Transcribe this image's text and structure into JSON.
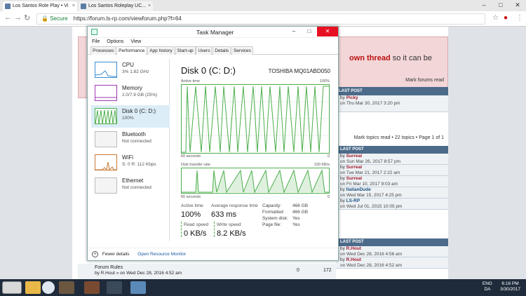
{
  "browser": {
    "tabs": [
      {
        "label": "Los Santos Role Play • Vi"
      },
      {
        "label": "Los Santos Roleplay UC..."
      }
    ],
    "url": "https://forum.ls-rp.com/viewforum.php?f=64",
    "secure_label": "Secure"
  },
  "forum": {
    "notice_thread": "own thread",
    "notice_tail": " so it can be",
    "mark_forums_read": "Mark forums read",
    "last_post_header": "LAST POST",
    "top_lastpost": {
      "by": "by",
      "user": "Picky",
      "on": "on Thu Mar 30, 2017 3:20 pm"
    },
    "topic_meta": "Mark topics read • 22 topics • Page 1 of 1",
    "announcements": [
      {
        "user": "Surreal",
        "on": "on Sun Mar 26, 2017 8:57 pm"
      },
      {
        "user": "Surreal",
        "on": "on Tue Mar 21, 2017 2:22 am"
      },
      {
        "user": "Surreal",
        "on": "on Fri Mar 10, 2017 9:03 am"
      },
      {
        "user": "ItalianDude",
        "on": "on Wed Mar 15, 2017 4:25 pm"
      },
      {
        "user": "LS-RP",
        "on": "on Wed Jul 01, 2015 10:05 pm"
      }
    ],
    "topics": [
      {
        "user": "R.Hout",
        "on": "on Wed Dec 28, 2016 4:56 am"
      },
      {
        "user": "R.Hout",
        "on": "on Wed Dec 28, 2016 4:52 am"
      }
    ],
    "bottom_row": {
      "title": "Forum Rules",
      "by": "by R.Hout » on Wed Dec 28, 2016 4:52 am",
      "replies": "0",
      "views": "172"
    }
  },
  "task_manager": {
    "title": "Task Manager",
    "menu": [
      "File",
      "Options",
      "View"
    ],
    "tabs": [
      "Processes",
      "Performance",
      "App history",
      "Start-up",
      "Users",
      "Details",
      "Services"
    ],
    "selected_tab": "Performance",
    "sidebar": [
      {
        "name": "CPU",
        "sub": "3% 1.82 GHz"
      },
      {
        "name": "Memory",
        "sub": "2.0/7.9 GB (25%)"
      },
      {
        "name": "Disk 0 (C: D:)",
        "sub": "100%"
      },
      {
        "name": "Bluetooth",
        "sub": "Not connected"
      },
      {
        "name": "WiFi",
        "sub": "S: 0 R: 112 Kbps"
      },
      {
        "name": "Ethernet",
        "sub": "Not connected"
      }
    ],
    "disk_title": "Disk 0 (C: D:)",
    "disk_model": "TOSHIBA MQ01ABD050",
    "graph1_label": "Active time",
    "graph1_max": "100%",
    "graph1_left": "60 seconds",
    "graph1_right": "0",
    "graph2_label": "Disk transfer rate",
    "graph2_max": "100 KB/s",
    "graph2_left": "60 seconds",
    "graph2_right": "0",
    "active_time_label": "Active time",
    "active_time": "100%",
    "avg_resp_label": "Average response time",
    "avg_resp": "633 ms",
    "read_label": "Read speed",
    "read": "0 KB/s",
    "write_label": "Write speed",
    "write": "8.2 KB/s",
    "details": [
      {
        "k": "Capacity:",
        "v": "466 GB"
      },
      {
        "k": "Formatted:",
        "v": "466 GB"
      },
      {
        "k": "System disk:",
        "v": "Yes"
      },
      {
        "k": "Page file:",
        "v": "Yes"
      }
    ],
    "fewer_details": "Fewer details",
    "open_resmon": "Open Resource Monitor"
  },
  "taskbar": {
    "lang": "ENG",
    "lang2": "DA",
    "time": "6:16 PM",
    "date": "3/30/2017"
  },
  "colors": {
    "graph_green": "#4cae4c",
    "sel_blue": "#dcedf7",
    "close_red": "#e81123"
  }
}
